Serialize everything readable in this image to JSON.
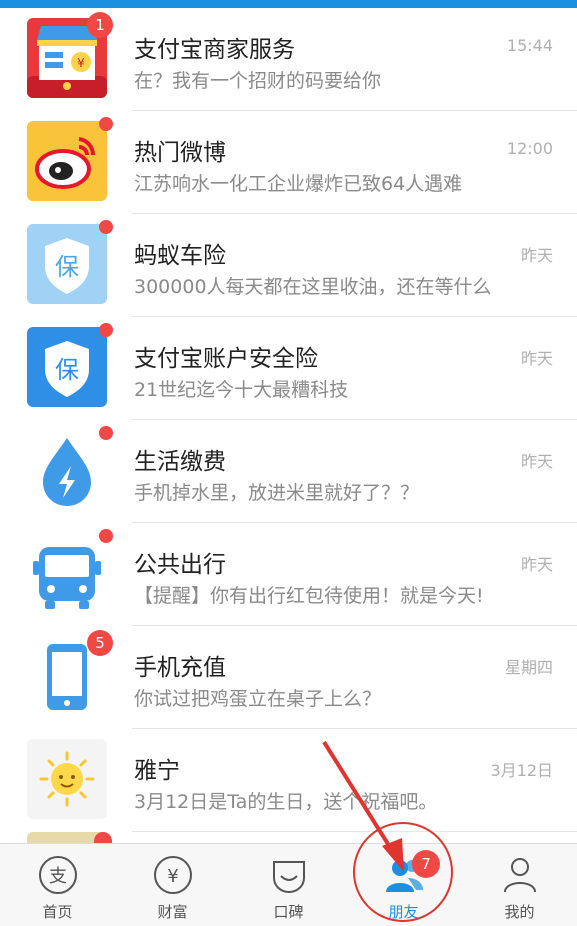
{
  "colors": {
    "accent": "#1b8fe0",
    "badge": "#f04844",
    "annotation": "#e0352f"
  },
  "items": [
    {
      "title": "支付宝商家服务",
      "subtitle": "在？我有一个招财的码要给你",
      "time": "15:44",
      "badge": "1",
      "icon": "merchant-shop-icon"
    },
    {
      "title": "热门微博",
      "subtitle": "江苏响水一化工企业爆炸已致64人遇难",
      "time": "12:00",
      "dot": true,
      "icon": "weibo-icon"
    },
    {
      "title": "蚂蚁车险",
      "subtitle": "300000人每天都在这里收油，还在等什么",
      "time": "昨天",
      "dot": true,
      "icon": "car-insurance-shield-icon"
    },
    {
      "title": "支付宝账户安全险",
      "subtitle": "21世纪迄今十大最糟科技",
      "time": "昨天",
      "dot": true,
      "icon": "account-insurance-shield-icon"
    },
    {
      "title": "生活缴费",
      "subtitle": "手机掉水里，放进米里就好了？？",
      "time": "昨天",
      "dot": true,
      "icon": "water-drop-bolt-icon"
    },
    {
      "title": "公共出行",
      "subtitle": "【提醒】你有出行红包待使用！就是今天!",
      "time": "昨天",
      "dot": true,
      "icon": "bus-icon"
    },
    {
      "title": "手机充值",
      "subtitle": "你试过把鸡蛋立在桌子上么？",
      "time": "星期四",
      "badge": "5",
      "icon": "phone-icon"
    },
    {
      "title": "雅宁",
      "subtitle": "3月12日是Ta的生日，送个祝福吧。",
      "time": "3月12日",
      "icon": "sun-icon"
    }
  ],
  "tabbar": {
    "tabs": [
      {
        "label": "首页",
        "icon": "home-zhi-icon"
      },
      {
        "label": "财富",
        "icon": "wealth-yen-icon"
      },
      {
        "label": "口碑",
        "icon": "koubei-icon"
      },
      {
        "label": "朋友",
        "icon": "friends-icon",
        "active": true,
        "badge": "7"
      },
      {
        "label": "我的",
        "icon": "profile-icon"
      }
    ]
  }
}
